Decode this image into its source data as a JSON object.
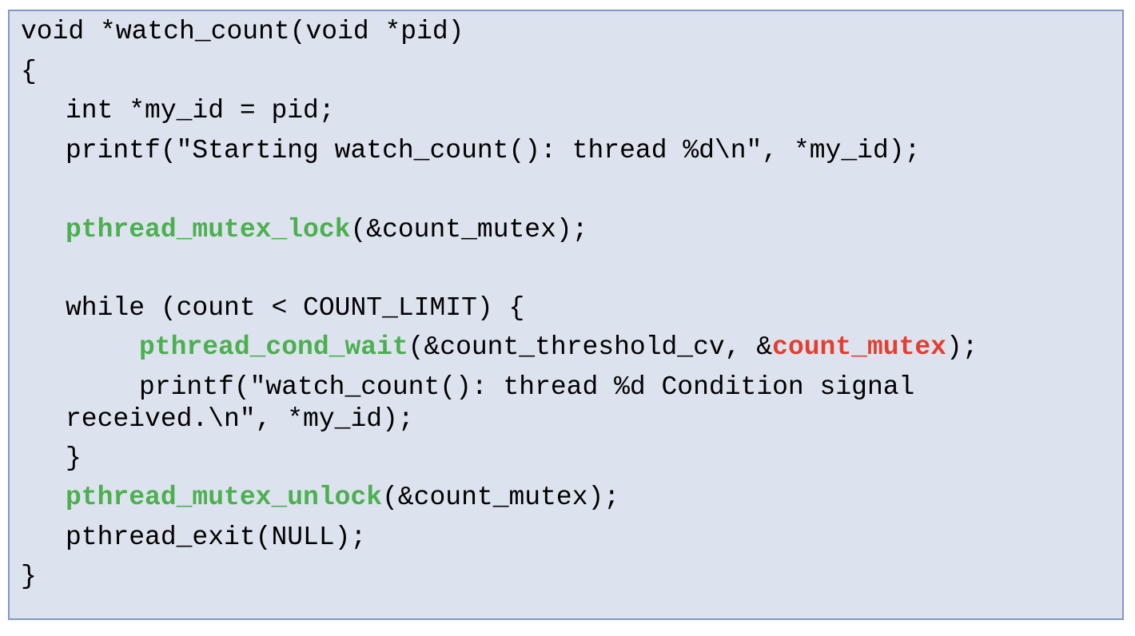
{
  "colors": {
    "background": "#dde3ee",
    "border": "#7f99c7",
    "text": "#000000",
    "function_highlight": "#4caf50",
    "argument_highlight": "#e53e30"
  },
  "code": {
    "line1": "void *watch_count(void *pid)",
    "line2": "{",
    "line3": "int *my_id = pid;",
    "line4": "printf(\"Starting watch_count(): thread %d\\n\", *my_id);",
    "line5_fn": "pthread_mutex_lock",
    "line5_rest": "(&count_mutex);",
    "line6": "while (count < COUNT_LIMIT) {",
    "line7_fn": "pthread_cond_wait",
    "line7_mid": "(&count_threshold_cv, &",
    "line7_hl": "count_mutex",
    "line7_end": ");",
    "line8": "printf(\"watch_count(): thread %d Condition signal",
    "line9": "received.\\n\", *my_id);",
    "line10": "}",
    "line11_fn": "pthread_mutex_unlock",
    "line11_rest": "(&count_mutex);",
    "line12": "pthread_exit(NULL);",
    "line13": "}"
  }
}
